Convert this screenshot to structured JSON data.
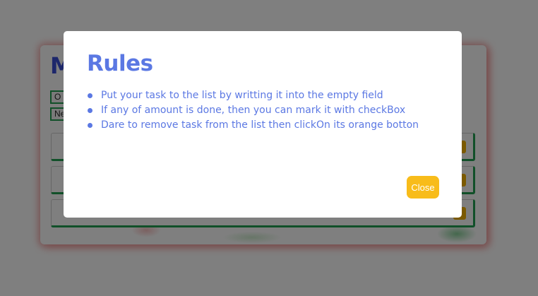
{
  "background_app": {
    "title": "M",
    "buttons": [
      "O",
      "Ne"
    ],
    "tasks": [
      {
        "label": ""
      },
      {
        "label": ""
      },
      {
        "label": ""
      }
    ]
  },
  "modal": {
    "title": "Rules",
    "rules": [
      "Put your task to the list by writting it into the empty field",
      "If any of amount is done, then you can mark it with checkBox",
      "Dare to remove task from the list then clickOn its orange botton"
    ],
    "close_label": "Close"
  },
  "colors": {
    "accent_blue": "#5b78e3",
    "close_button": "#f8bc1a",
    "task_border_green": "#22a052",
    "overlay": "rgba(0,0,0,0.5)"
  }
}
